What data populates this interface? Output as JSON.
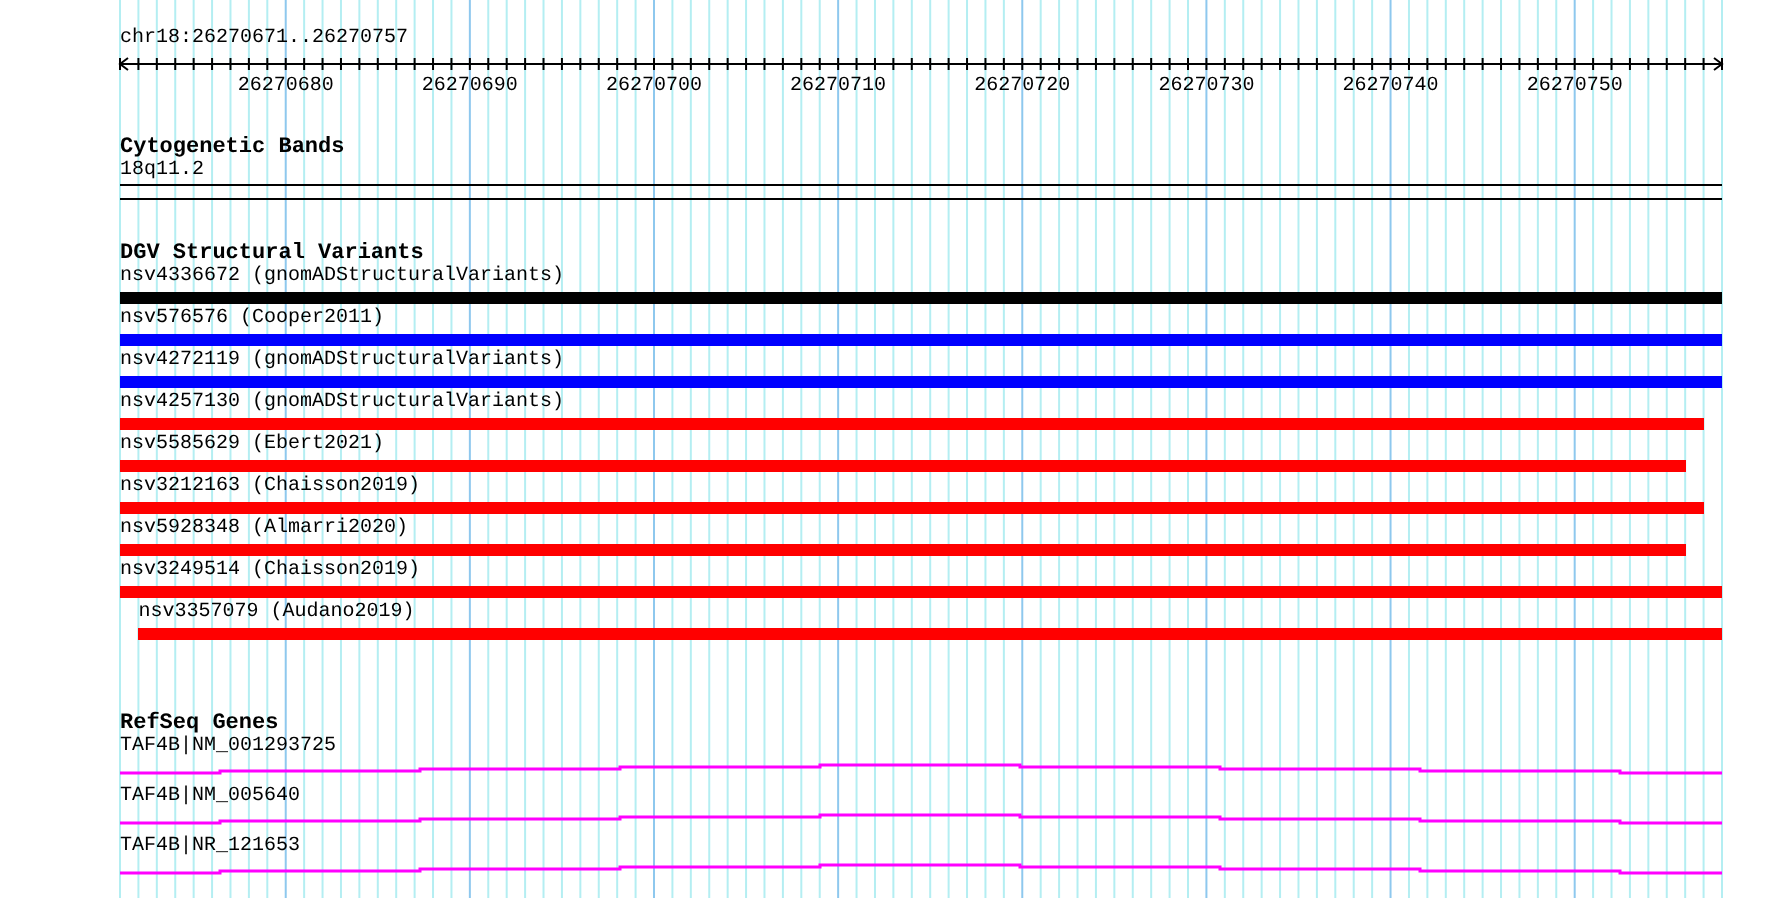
{
  "ruler": {
    "location": "chr18:26270671..26270757",
    "tick_labels": [
      "26270680",
      "26270690",
      "26270700",
      "26270710",
      "26270720",
      "26270730",
      "26270740",
      "26270750"
    ]
  },
  "tracks": [
    {
      "kind": "bands",
      "title": "Cytogenetic Bands",
      "items": [
        {
          "label": "18q11.2"
        }
      ]
    },
    {
      "kind": "variants",
      "title": "DGV Structural Variants",
      "items": [
        {
          "label": "nsv4336672 (gnomADStructuralVariants)",
          "color": "#000000"
        },
        {
          "label": "nsv576576 (Cooper2011)",
          "color": "#0000ff"
        },
        {
          "label": "nsv4272119 (gnomADStructuralVariants)",
          "color": "#0000ff"
        },
        {
          "label": "nsv4257130 (gnomADStructuralVariants)",
          "color": "#ff0000"
        },
        {
          "label": "nsv5585629 (Ebert2021)",
          "color": "#ff0000"
        },
        {
          "label": "nsv3212163 (Chaisson2019)",
          "color": "#ff0000"
        },
        {
          "label": "nsv5928348 (Almarri2020)",
          "color": "#ff0000"
        },
        {
          "label": "nsv3249514 (Chaisson2019)",
          "color": "#ff0000"
        },
        {
          "label": "nsv3357079 (Audano2019)",
          "color": "#ff0000"
        }
      ]
    },
    {
      "kind": "genes",
      "title": "RefSeq Genes",
      "items": [
        {
          "label": "TAF4B|NM_001293725"
        },
        {
          "label": "TAF4B|NM_005640"
        },
        {
          "label": "TAF4B|NR_121653"
        }
      ]
    }
  ]
}
